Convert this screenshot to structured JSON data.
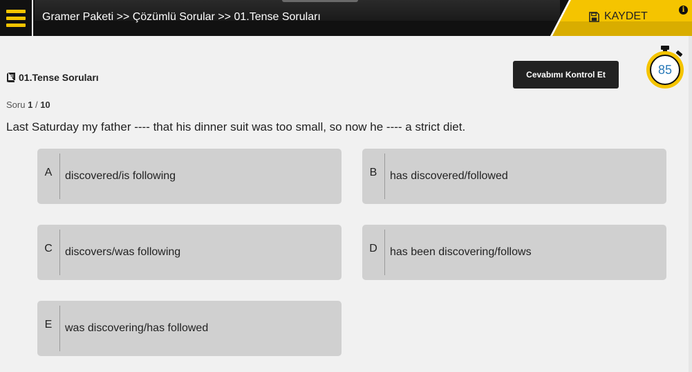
{
  "header": {
    "breadcrumb": "Gramer Paketi >> Çözümlü Sorular >> 01.Tense Soruları",
    "save_label": "KAYDET",
    "info_symbol": "i"
  },
  "quiz": {
    "title": "01.Tense Soruları",
    "counter_prefix": "Soru",
    "current": "1",
    "separator": "/",
    "total": "10",
    "check_label": "Cevabımı Kontrol Et",
    "timer_value": "85",
    "question": "Last Saturday my father ---- that his dinner suit was too small, so now he ---- a strict diet."
  },
  "options": [
    {
      "letter": "A",
      "text": "discovered/is following"
    },
    {
      "letter": "B",
      "text": "has discovered/followed"
    },
    {
      "letter": "C",
      "text": "discovers/was following"
    },
    {
      "letter": "D",
      "text": "has been discovering/follows"
    },
    {
      "letter": "E",
      "text": "was discovering/has followed"
    }
  ],
  "colors": {
    "accent": "#f5c400",
    "header_bg": "#111111",
    "option_bg": "#d0d0d0",
    "timer_text": "#2b7bb9"
  },
  "icons": {
    "menu": "hamburger-menu-icon",
    "save": "floppy-disk-icon",
    "info": "info-icon",
    "title": "book-icon",
    "timer": "stopwatch-icon"
  }
}
